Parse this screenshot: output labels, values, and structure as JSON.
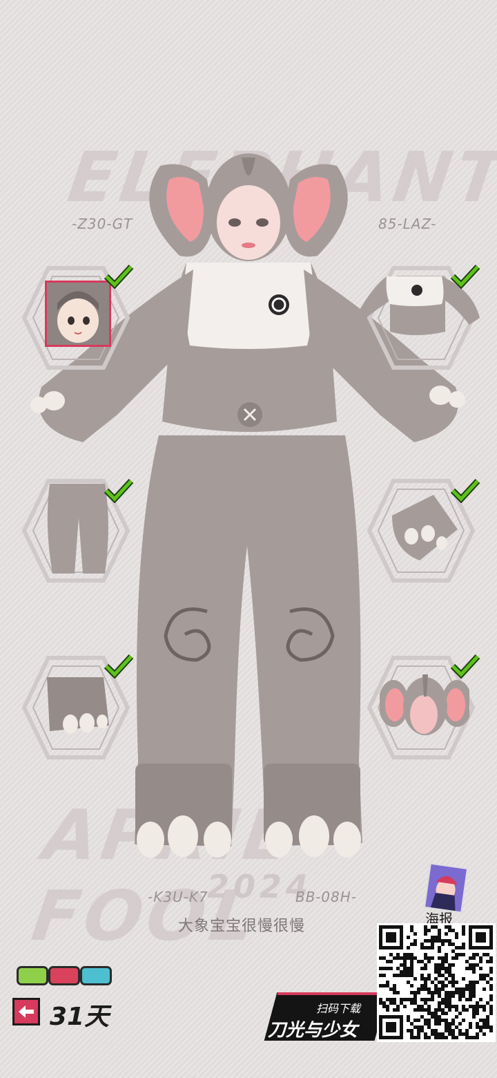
{
  "background_words": {
    "top": "ELEPHANT",
    "bottom": "APRIL FOOL",
    "year": "2024"
  },
  "codes": {
    "top_left": "-Z30-GT",
    "top_right": "85-LAZ-",
    "bottom_left": "-K3U-K7",
    "bottom_right": "BB-08H-"
  },
  "outfit_name": "大象宝宝很慢很慢",
  "days": "31天",
  "poster": {
    "label": "海报"
  },
  "promo": {
    "scan_label": "扫码下载",
    "game_title": "刀光与少女"
  },
  "slots": [
    {
      "name": "头像",
      "icon": "avatar-icon",
      "owned": true
    },
    {
      "name": "上衣",
      "icon": "top-icon",
      "owned": true
    },
    {
      "name": "裤子",
      "icon": "pants-icon",
      "owned": true
    },
    {
      "name": "手套",
      "icon": "glove-icon",
      "owned": true
    },
    {
      "name": "鞋子",
      "icon": "shoe-icon",
      "owned": true
    },
    {
      "name": "头饰",
      "icon": "headwear-icon",
      "owned": true
    }
  ],
  "colors": {
    "check": "#5fc21a",
    "accent": "#d63a5c",
    "chip1": "#8fd04a",
    "chip2": "#d8435b",
    "chip3": "#4dbfd0",
    "suit": "#a79e9c",
    "suit_white": "#f2efec"
  }
}
